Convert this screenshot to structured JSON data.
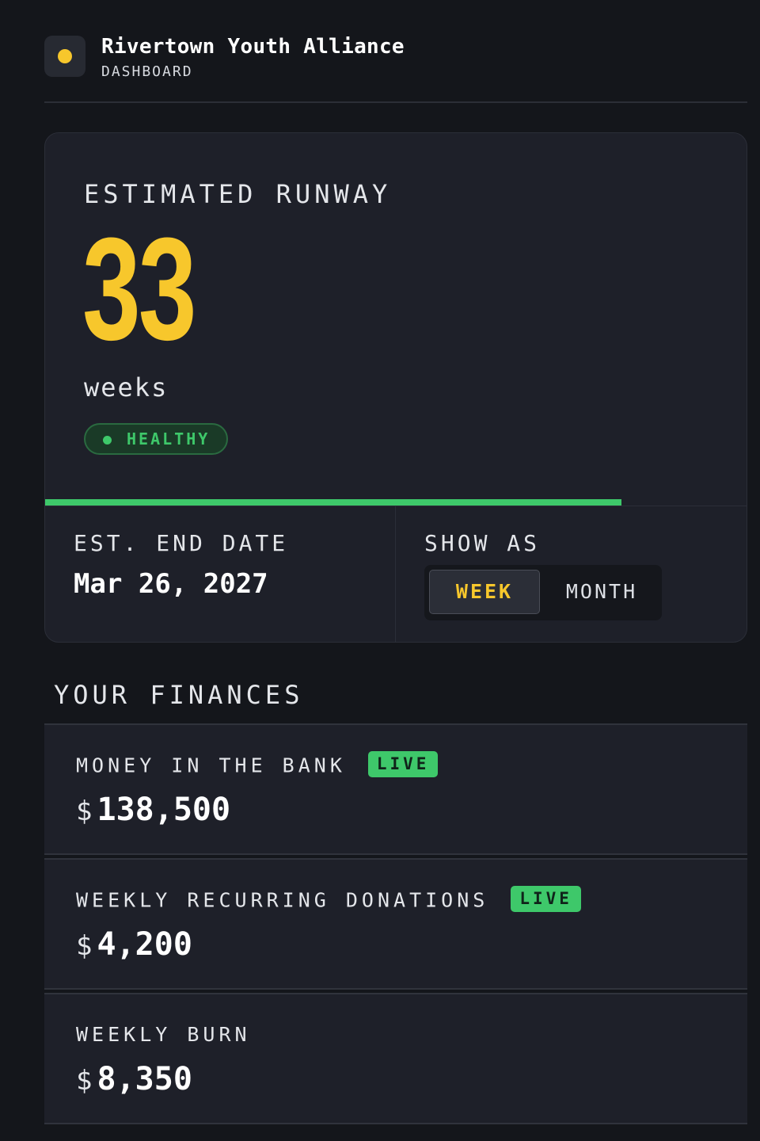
{
  "header": {
    "org_name": "Rivertown Youth Alliance",
    "subtitle": "DASHBOARD",
    "logo_color": "#f7c72c"
  },
  "runway": {
    "label": "ESTIMATED RUNWAY",
    "value": "33",
    "unit": "weeks",
    "status": "HEALTHY",
    "status_color": "#3ec86a",
    "progress_fraction": 0.82,
    "end_date_label": "EST. END DATE",
    "end_date": "Mar 26, 2027",
    "show_as_label": "SHOW AS",
    "show_as_options": [
      "WEEK",
      "MONTH"
    ],
    "show_as_selected": "WEEK"
  },
  "finances": {
    "title": "YOUR FINANCES",
    "items": [
      {
        "label": "MONEY IN THE BANK",
        "badge": "LIVE",
        "currency": "$",
        "amount": "138,500"
      },
      {
        "label": "WEEKLY RECURRING DONATIONS",
        "badge": "LIVE",
        "currency": "$",
        "amount": "4,200"
      },
      {
        "label": "WEEKLY BURN",
        "badge": "",
        "currency": "$",
        "amount": "8,350"
      }
    ]
  },
  "colors": {
    "accent": "#f7c72c",
    "success": "#3ec86a",
    "background": "#14161b",
    "card": "#1e2029"
  }
}
